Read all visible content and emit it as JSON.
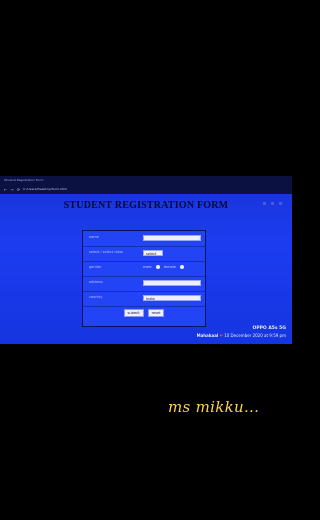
{
  "browser": {
    "tab_text": "Student Registration Form",
    "nav_back": "←",
    "nav_forward": "→",
    "nav_reload": "⟳",
    "url": "C:/Users/Desktop/form.html"
  },
  "page": {
    "title": "STUDENT REGISTRATION FORM"
  },
  "form": {
    "name_label": "name",
    "name_value": "",
    "course_label": "select / select   class",
    "course_value": "select",
    "gender_label": "gender",
    "gender_opt1": "male",
    "gender_opt2": "female",
    "address_label": "address",
    "address_value": "",
    "country_label": "country",
    "country_value": "India",
    "submit_label": "submit",
    "reset_label": "reset"
  },
  "watermark": {
    "device": "OPPO A5s 5G",
    "name": "Mahakaal",
    "heart": "❤",
    "timestamp": "10 December 2020 at 9:59 pm"
  },
  "caption": {
    "text": "ms mikku..."
  }
}
